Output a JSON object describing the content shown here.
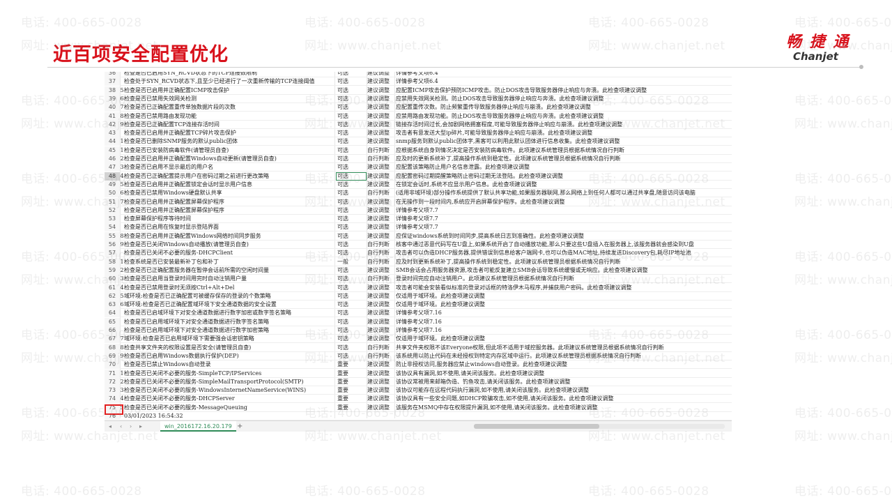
{
  "slide": {
    "title": "近百项安全配置优化",
    "watermark_phone": "电话: 400-665-0028",
    "watermark_url": "网址: www.chanjet.net"
  },
  "logo": {
    "cn": "畅 捷 通",
    "en": "Chanjet"
  },
  "sheet": {
    "rows": [
      {
        "n": "36",
        "a": "",
        "b": "检查是否已启用SYN_RCVD状态下的TCP连接数限制",
        "c": "可选",
        "d": "建议调整",
        "e": "详情参考父项6.4"
      },
      {
        "n": "37",
        "a": "",
        "b": "检查处于SYN_RCVD状态下,且至少已经进行了一次重新传输的TCP连接阈值",
        "c": "可选",
        "d": "建议调整",
        "e": "详情参考父项6.4"
      },
      {
        "n": "38",
        "a": "5",
        "b": "检查是否已启用并正确配置ICMP攻击保护",
        "c": "可选",
        "d": "建议调整",
        "e": "应配置ICMP攻击保护预防ICMP攻击。防止DOS攻击导致服务器停止响应与奔溃。此检查项建议调整"
      },
      {
        "n": "39",
        "a": "6",
        "b": "检查是否已禁用失效网关检测",
        "c": "可选",
        "d": "建议调整",
        "e": "应禁用失效网关检测。防止DOS攻击导致服务器停止响应与奔溃。此检查项建议调整"
      },
      {
        "n": "40",
        "a": "7",
        "b": "检查是否已正确配置重传单独数据片段的次数",
        "c": "可选",
        "d": "建议调整",
        "e": "应配置重传次数。防止频繁重传导致服务器停止响应与崩溃。此检查项建议调整"
      },
      {
        "n": "41",
        "a": "8",
        "b": "检查是否已禁用路由发现功能",
        "c": "可选",
        "d": "建议调整",
        "e": "应禁用路由发现功能。防止DOS攻击导致服务器停止响应与奔溃。此检查项建议调整"
      },
      {
        "n": "42",
        "a": "9",
        "b": "检查是否已正确配置TCP连接存活时间",
        "c": "可选",
        "d": "建议调整",
        "e": "链接存活时间过长,会加剧网络拥塞程度,可能导致服务器停止响应与崩溃。此检查项建议调整"
      },
      {
        "n": "43",
        "a": "",
        "b": "检查是否已启用并正确配置TCP碎片攻击保护",
        "c": "可选",
        "d": "建议调整",
        "e": "攻击者有意发送大型ip碎片,可能导致服务器停止响应与崩溃。此检查项建议调整"
      },
      {
        "n": "44",
        "a": "1",
        "b": "检查是否已删除SNMP服务的默认public团体",
        "c": "可选",
        "d": "建议调整",
        "e": "snmp服务到默认public团体字,黑客可以利用此默认团体进行信息收集。此检查项建议调整"
      },
      {
        "n": "45",
        "a": "1",
        "b": "检查是否已安装防病毒软件(请管理员自查)",
        "c": "可选",
        "d": "自行判断",
        "e": "应根据系统自身到情况决定是否安装防病毒软件。此项建议系统管理员根据系统情况自行判断"
      },
      {
        "n": "46",
        "a": "2",
        "b": "检查是否已启用并正确配置Windows自动更新(请管理员自查)",
        "c": "可选",
        "d": "自行判断",
        "e": "应及时的更新系统补丁,提高操作系统到稳定性。此项建议系统管理员根据系统情况自行判断"
      },
      {
        "n": "47",
        "a": "3",
        "b": "检查是否已启用不显示最后的用户名",
        "c": "可选",
        "d": "建议调整",
        "e": "应配置该策略防止用户名信息泄露。此检查项建议调整"
      },
      {
        "n": "48",
        "a": "4",
        "b": "检查是否已正确配置提示用户在密码过期之前进行更改策略",
        "c": "可选",
        "d": "建议调整",
        "e": "应配置密码过期提醒策略防止密码过期无法登陆。此检查项建议调整"
      },
      {
        "n": "49",
        "a": "5",
        "b": "检查是否已启用并正确配置锁定会话时显示用户信息",
        "c": "可选",
        "d": "建议调整",
        "e": "在锁定会话时,系统不应显示用户信息。此检查项建议调整"
      },
      {
        "n": "50",
        "a": "6",
        "b": "检查是否已禁用Windows硬盘默认共享",
        "c": "可选",
        "d": "自行判断",
        "e": "(适用非域环境)部分操作系统提供了默认共享功能,如果服务器联网,那么网络上到任何人都可以通过共享盘,随意访问该电脑"
      },
      {
        "n": "51",
        "a": "7",
        "b": "检查是否已启用并正确配置屏幕保护程序",
        "c": "可选",
        "d": "建议调整",
        "e": "在无操作到一段时间内,系统应开启屏幕保护程序。此检查项建议调整"
      },
      {
        "n": "52",
        "a": "",
        "b": "检查是否已启用并正确配置屏幕保护程序",
        "c": "可选",
        "d": "建议调整",
        "e": "详情参考父项7.7"
      },
      {
        "n": "53",
        "a": "",
        "b": "检查屏幕保护程序等待时间",
        "c": "可选",
        "d": "建议调整",
        "e": "详情参考父项7.7"
      },
      {
        "n": "54",
        "a": "",
        "b": "检查是否已启用在恢复时显示登陆界面",
        "c": "可选",
        "d": "建议调整",
        "e": "详情参考父项7.7"
      },
      {
        "n": "55",
        "a": "8",
        "b": "检查是否已启用并正确配置Windows网络时间同步服务",
        "c": "可选",
        "d": "建议调整",
        "e": "应保证windows系统到时间同步,提高系统日志到准确性。此检查项建议调整"
      },
      {
        "n": "56",
        "a": "9",
        "b": "检查是否已关闭Windows自动播放(请管理员自查)",
        "c": "可选",
        "d": "自行判断",
        "e": "核客中通过恶意代码写在U盘上,如果系统开启了自动播放功能,那么只要这些U盘插入在服务器上,该服务器就会感染到U盘"
      },
      {
        "n": "57",
        "a": "",
        "b": "检查是否已关闭不必要的服务-DHCPClient",
        "c": "可选",
        "d": "自行判断",
        "e": "攻击者可以伪造DHCP服务器,提供错误到信息给客户端网卡,也可以伪造MAC地址,持续发送Discovery包,耗尽IP地址池"
      },
      {
        "n": "58",
        "a": "1",
        "b": "检查系统是否已安装最新补丁包和补丁",
        "c": "一般",
        "d": "自行判断",
        "e": "应及时到更新系统补丁,提高操作系统到稳定性。此项建议系统管理员根据系统情况自行判断"
      },
      {
        "n": "59",
        "a": "2",
        "b": "检查是否已正确配置服务器在暂停会话前所需的空闲时间量",
        "c": "可选",
        "d": "建议调整",
        "e": "SMB会话会占用服务器资源,攻击者可能反复建立SMB会话导致系统缓慢或无响应。此检查项建议调整"
      },
      {
        "n": "60",
        "a": "3",
        "b": "检查是否已启用当登录时间用完时自动注销用户量",
        "c": "可选",
        "d": "自行判断",
        "e": "登录时间完应自动注销用户。此项建议系统管理员根据系统情况自行判断"
      },
      {
        "n": "61",
        "a": "4",
        "b": "检查是否已禁用登录时无须按Ctrl+Alt+Del",
        "c": "可选",
        "d": "建议调整",
        "e": "攻击者可能会安装看似标准的登录对话框的特洛伊木马程序,并捕获用户密码。此检查项建议调整"
      },
      {
        "n": "62",
        "a": "5",
        "b": "域环境:检查是否已正确配置可被缓存保存的登录的个数策略",
        "c": "可选",
        "d": "建议调整",
        "e": "仅适用于域环境。此检查项建议调整"
      },
      {
        "n": "63",
        "a": "6",
        "b": "域环境:检查是否已正确配置域环境下安全通道数据的安全设置",
        "c": "可选",
        "d": "建议调整",
        "e": "仅适用于域环境。此检查项建议调整"
      },
      {
        "n": "64",
        "a": "",
        "b": "检查是否已启域环境下对安全通道数据进行数字加密或数字签名策略",
        "c": "可选",
        "d": "建议调整",
        "e": "详情参考父项7.16"
      },
      {
        "n": "65",
        "a": "",
        "b": "检查是否已启用域环境下对安全通道数据进行数字签名策略",
        "c": "可选",
        "d": "建议调整",
        "e": "详情参考父项7.16"
      },
      {
        "n": "66",
        "a": "",
        "b": "检查是否已启用域环境下对安全通道数据进行数字加密策略",
        "c": "可选",
        "d": "建议调整",
        "e": "详情参考父项7.16"
      },
      {
        "n": "67",
        "a": "7",
        "b": "域环境:检查是否已启用域环境下需要强会话密钥策略",
        "c": "可选",
        "d": "建议调整",
        "e": "仅适用于域环境。此检查项建议调整"
      },
      {
        "n": "68",
        "a": "8",
        "b": "检查共享文件夹的权限设置是否安全(请管理员自查)",
        "c": "可选",
        "d": "自行判断",
        "e": "共享文件夹权限不该Everyone权限,但此项不适用于域控服务器。此项建议系统管理员根据系统情况自行判断"
      },
      {
        "n": "69",
        "a": "9",
        "b": "检查是否已启用Windows数据执行保护(DEP)",
        "c": "可选",
        "d": "自行判断",
        "e": "该系统用以防止代码在未经授权到特定内存区域中运行。此项建议系统管理员根据系统情况自行判断"
      },
      {
        "n": "70",
        "a": "",
        "b": "检查是否已禁止Windows自动登录",
        "c": "重要",
        "d": "建议调整",
        "e": "防止非授权访问,服务器应禁止windows自动登录。此检查项建议调整"
      },
      {
        "n": "71",
        "a": "1",
        "b": "检查是否已关闭不必要的服务-SimpleTCP/IPServices",
        "c": "重要",
        "d": "建议调整",
        "e": "该协议具有漏洞,如不使用,请关闭该服务。此检查项建议调整"
      },
      {
        "n": "72",
        "a": "2",
        "b": "检查是否已关闭不必要的服务-SimpleMailTransportProtocol(SMTP)",
        "c": "重要",
        "d": "建议调整",
        "e": "该协议常被用来邮箱伪造、钓鱼攻击,请关闭该服务。此检查项建议调整"
      },
      {
        "n": "73",
        "a": "3",
        "b": "检查是否已关闭不必要的服务-WindowsInternetNameService(WINS)",
        "c": "重要",
        "d": "建议调整",
        "e": "该协议可能存在远程代码执行漏洞,如不使用,请关闭该服务。此检查项建议调整"
      },
      {
        "n": "74",
        "a": "4",
        "b": "检查是否已关闭不必要的服务-DHCPServer",
        "c": "重要",
        "d": "建议调整",
        "e": "该协议具有一些安全问题,如DHCP欺骗攻击,如不使用,请关闭该服务。此检查项建议调整"
      },
      {
        "n": "75",
        "a": "5",
        "b": "检查是否已关闭不必要的服务-MessageQueuing",
        "c": "重要",
        "d": "建议调整",
        "e": "该服务在MSMQ中存在权限提升漏洞,如不使用,请关闭该服务。此检查项建议调整"
      },
      {
        "n": "76",
        "a": "",
        "b": "03/01/2023 16:54:32",
        "c": "",
        "d": "",
        "e": ""
      }
    ],
    "selected_row": "48",
    "sheet_tab": "win_2016172.16.20.179",
    "add_tab": "+"
  }
}
